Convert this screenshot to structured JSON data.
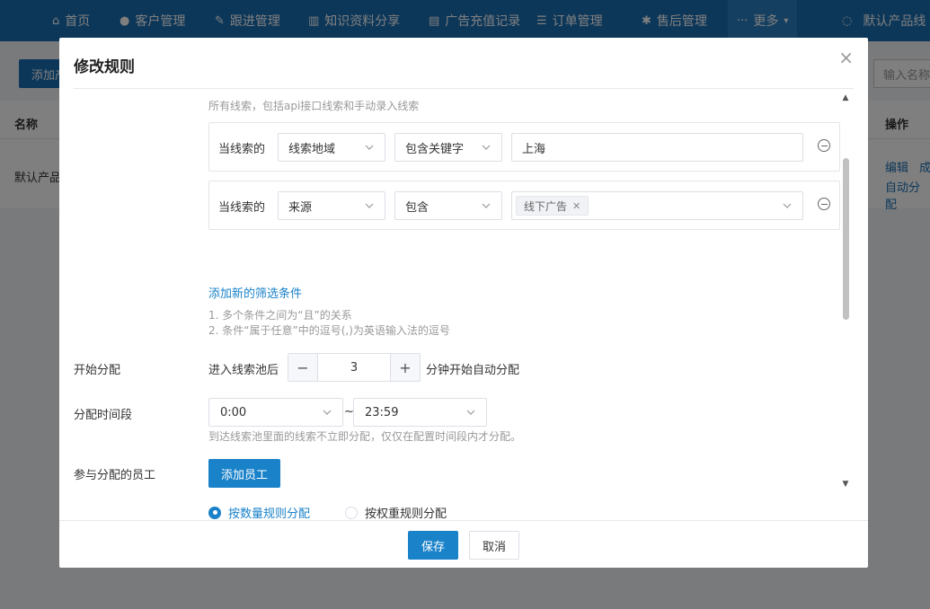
{
  "topnav": {
    "items": [
      {
        "icon": "home-icon",
        "label": "首页"
      },
      {
        "icon": "user-icon",
        "label": "客户管理"
      },
      {
        "icon": "edit-icon",
        "label": "跟进管理"
      },
      {
        "icon": "book-icon",
        "label": "知识资料分享"
      },
      {
        "icon": "document-icon",
        "label": "广告充值记录"
      },
      {
        "icon": "list-icon",
        "label": "订单管理"
      },
      {
        "icon": "wrench-icon",
        "label": "售后管理"
      },
      {
        "icon": "more-icon",
        "label": "更多"
      },
      {
        "icon": "chat-icon",
        "label": "默认产品线"
      }
    ]
  },
  "background": {
    "add_button": "添加产",
    "search_placeholder": "输入名称",
    "col_name": "名称",
    "col_actions": "操作",
    "row_name": "默认产品",
    "row_action_edit": "编辑",
    "row_action_2": "成",
    "row_action_auto": "自动分配"
  },
  "modal": {
    "title": "修改规则",
    "all_leads_hint": "所有线索，包括api接口线索和手动录入线索",
    "conditions": [
      {
        "label": "当线索的",
        "field": "线索地域",
        "operator": "包含关键字",
        "value": "上海"
      },
      {
        "label": "当线索的",
        "field": "来源",
        "operator": "包含",
        "tags": [
          "线下广告"
        ]
      }
    ],
    "add_condition": "添加新的筛选条件",
    "notes": [
      "1. 多个条件之间为“且”的关系",
      "2. 条件“属于任意”中的逗号(,)为英语输入法的逗号"
    ],
    "start_assign": {
      "label": "开始分配",
      "prefix": "进入线索池后",
      "value": "3",
      "suffix": "分钟开始自动分配"
    },
    "time_range": {
      "label": "分配时间段",
      "start": "0:00",
      "sep": "~",
      "end": "23:59",
      "hint": "到达线索池里面的线索不立即分配，仅仅在配置时间段内才分配。"
    },
    "staff": {
      "label": "参与分配的员工",
      "add_button": "添加员工",
      "radio_count": "按数量规则分配",
      "radio_weight": "按权重规则分配"
    },
    "footer": {
      "save": "保存",
      "cancel": "取消"
    }
  }
}
